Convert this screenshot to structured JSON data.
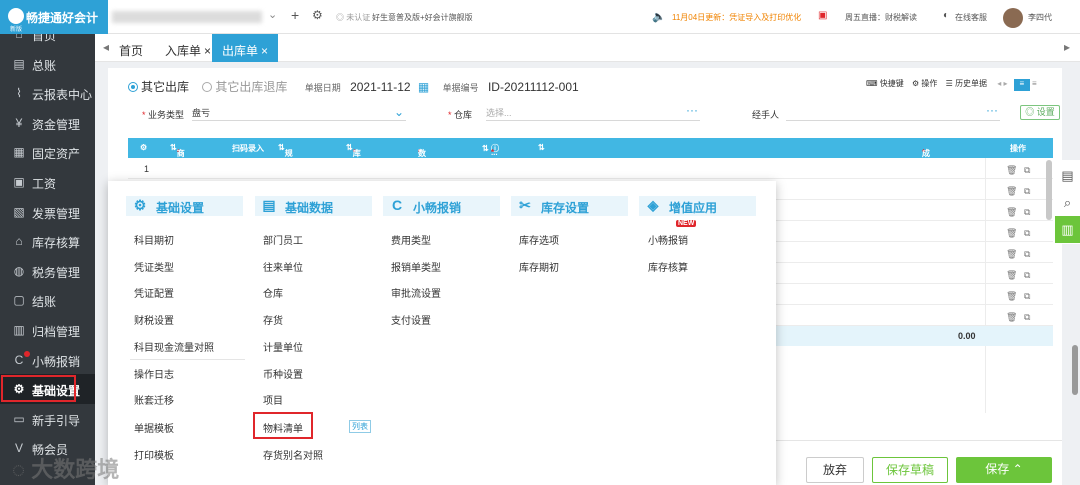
{
  "brand": {
    "name": "畅捷通好会计",
    "sub": "新版",
    "color": "#2ea1d6"
  },
  "topbar": {
    "uncertified": "未认证",
    "plan": "好生意普及版+好会计旗舰版",
    "notice": "11月04日更新：凭证导入及打印优化",
    "live": "周五直播：财税解读",
    "service": "在线客服",
    "user": "李四代"
  },
  "sidebar": {
    "items": [
      {
        "label": "首页",
        "icon": "home-icon"
      },
      {
        "label": "总账",
        "icon": "ledger-icon"
      },
      {
        "label": "云报表中心",
        "icon": "chart-icon"
      },
      {
        "label": "资金管理",
        "icon": "money-icon"
      },
      {
        "label": "固定资产",
        "icon": "asset-icon"
      },
      {
        "label": "工资",
        "icon": "salary-icon"
      },
      {
        "label": "发票管理",
        "icon": "invoice-icon"
      },
      {
        "label": "库存核算",
        "icon": "inventory-icon"
      },
      {
        "label": "税务管理",
        "icon": "tax-icon"
      },
      {
        "label": "结账",
        "icon": "close-books-icon"
      },
      {
        "label": "归档管理",
        "icon": "archive-icon"
      },
      {
        "label": "小畅报销",
        "icon": "reimburse-icon"
      },
      {
        "label": "基础设置",
        "icon": "gear-icon"
      },
      {
        "label": "新手引导",
        "icon": "guide-icon"
      },
      {
        "label": "畅会员",
        "icon": "vip-icon"
      }
    ]
  },
  "tabs": [
    {
      "label": "首页"
    },
    {
      "label": "入库单"
    },
    {
      "label": "出库单"
    }
  ],
  "form": {
    "radio_other_out": "其它出库",
    "radio_other_return": "其它出库退库",
    "doc_date_label": "单据日期",
    "doc_date": "2021-11-12",
    "doc_no_label": "单据编号",
    "doc_no": "ID-20211112-001",
    "quick_key": "快捷键",
    "operation": "操作",
    "history": "历史单据",
    "biz_type_label": "业务类型",
    "biz_type": "盘亏",
    "warehouse_label": "仓库",
    "warehouse_placeholder": "选择...",
    "handler_label": "经手人",
    "settings": "设置"
  },
  "table": {
    "headers": [
      "商品",
      "扫码录入",
      "规格型号",
      "库存单位",
      "数量",
      "...",
      "成本金额",
      "操作"
    ],
    "row1": "1",
    "total": "0.00"
  },
  "buttons": {
    "discard": "放弃",
    "save_draft": "保存草稿",
    "save": "保存"
  },
  "popup": {
    "columns": [
      {
        "title": "基础设置",
        "items": [
          "科目期初",
          "凭证类型",
          "凭证配置",
          "财税设置",
          "科目现金流量对照",
          "操作日志",
          "账套迁移",
          "单据模板",
          "打印模板"
        ]
      },
      {
        "title": "基础数据",
        "items": [
          "部门员工",
          "往来单位",
          "仓库",
          "存货",
          "计量单位",
          "币种设置",
          "项目",
          "物料清单",
          "存货别名对照"
        ]
      },
      {
        "title": "小畅报销",
        "items": [
          "费用类型",
          "报销单类型",
          "审批流设置",
          "支付设置"
        ]
      },
      {
        "title": "库存设置",
        "items": [
          "库存选项",
          "库存期初"
        ]
      },
      {
        "title": "增值应用",
        "items": [
          "小畅报销",
          "库存核算"
        ]
      }
    ],
    "new_badge": "NEW",
    "list_tag": "列表"
  },
  "watermark": "大数跨境"
}
